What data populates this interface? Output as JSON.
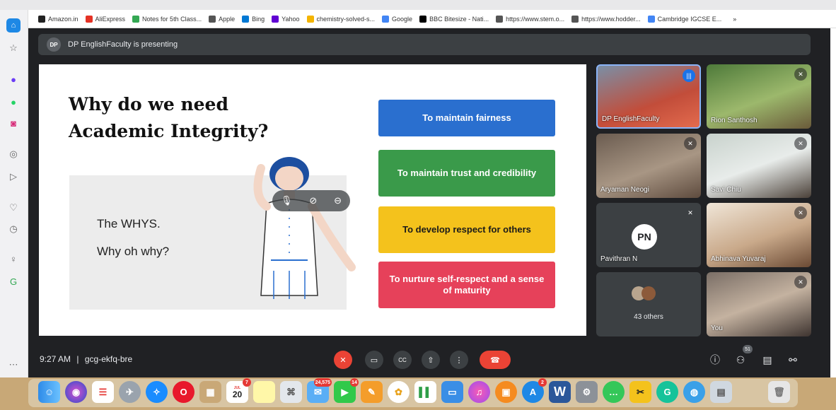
{
  "browser": {
    "bookmarks": [
      {
        "label": "Amazon.in",
        "color": "#222"
      },
      {
        "label": "AliExpress",
        "color": "#e43225"
      },
      {
        "label": "Notes for 5th Class...",
        "color": "#34a853"
      },
      {
        "label": "Apple",
        "color": "#555"
      },
      {
        "label": "Bing",
        "color": "#0078d4"
      },
      {
        "label": "Yahoo",
        "color": "#6001d2"
      },
      {
        "label": "chemistry-solved-s...",
        "color": "#f4b400"
      },
      {
        "label": "Google",
        "color": "#4285f4"
      },
      {
        "label": "BBC Bitesize - Nati...",
        "color": "#000"
      },
      {
        "label": "https://www.stem.o...",
        "color": "#555"
      },
      {
        "label": "https://www.hodder...",
        "color": "#555"
      },
      {
        "label": "Cambridge IGCSE E...",
        "color": "#4285f4"
      }
    ],
    "more": "»"
  },
  "presenting": {
    "avatar": "DP",
    "text": "DP EnglishFaculty is presenting"
  },
  "slide": {
    "title_line1": "Why do we need",
    "title_line2": "Academic Integrity?",
    "whys": "The WHYS.",
    "whyoh": "Why oh why?",
    "buttons": [
      {
        "label": "To maintain fairness",
        "color": "#2a6fcf"
      },
      {
        "label": "To maintain trust and credibility",
        "color": "#3a9a4a"
      },
      {
        "label": "To develop respect for others",
        "color": "#f4c21c"
      },
      {
        "label": "To nurture self-respect and a sense of maturity",
        "color": "#e6415a"
      }
    ]
  },
  "participants": [
    {
      "name": "DP EnglishFaculty",
      "status": "speaking"
    },
    {
      "name": "Rion Santhosh",
      "status": "muted"
    },
    {
      "name": "Aryaman Neogi",
      "status": "muted"
    },
    {
      "name": "Savi Chiu",
      "status": "muted"
    },
    {
      "name": "Pavithran N",
      "status": "muted",
      "avatar": "PN"
    },
    {
      "name": "Abhinava Yuvaraj",
      "status": "muted"
    },
    {
      "name": "43 others",
      "status": "group"
    },
    {
      "name": "You",
      "status": "muted"
    }
  ],
  "bottom": {
    "time": "9:27 AM",
    "separator": "|",
    "meeting_code": "gcg-ekfq-bre",
    "participant_count": "51"
  },
  "dock": {
    "calendar_day": "20",
    "calendar_month": "JUL",
    "badges": {
      "calendar": "7",
      "mail": "24,575",
      "facetime": "14",
      "appstore": "2"
    }
  }
}
